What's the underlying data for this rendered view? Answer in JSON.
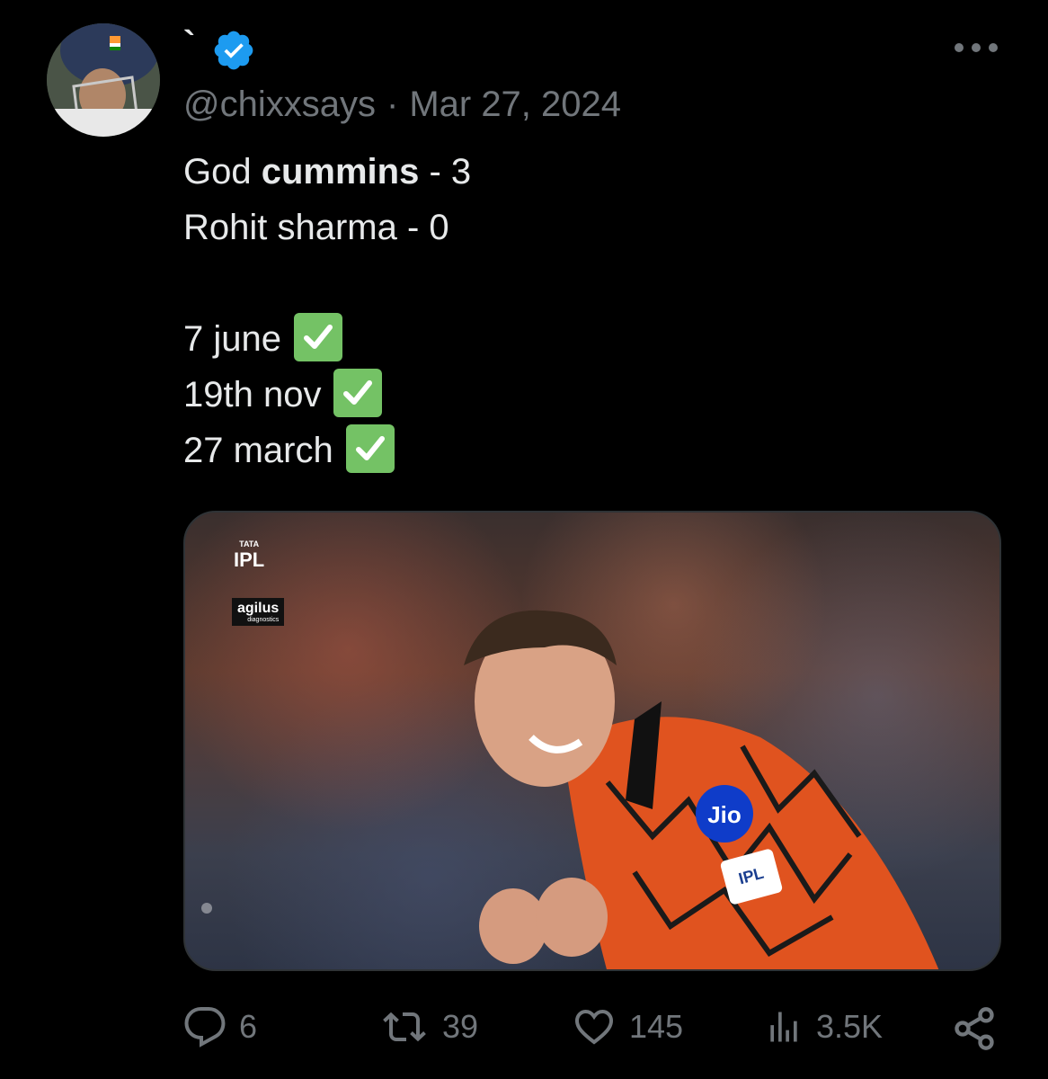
{
  "author": {
    "display_name": "`",
    "handle": "@chixxsays",
    "separator": "·",
    "date": "Mar 27, 2024"
  },
  "body": {
    "line1_prefix": "God ",
    "line1_bold": "cummins",
    "line1_suffix": " - 3",
    "line2": "Rohit sharma - 0",
    "line3": "7 june",
    "line4": "19th nov",
    "line5": "27 march"
  },
  "media": {
    "ipl_small": "TATA",
    "ipl_big": "IPL",
    "sponsor_name": "agilus",
    "sponsor_sub": "diagnostics",
    "shirt_badge": "Jio"
  },
  "actions": {
    "replies": "6",
    "reposts": "39",
    "likes": "145",
    "views": "3.5K"
  },
  "colors": {
    "verified": "#1d9bf0",
    "check": "#74c265",
    "muted": "#71767b"
  }
}
